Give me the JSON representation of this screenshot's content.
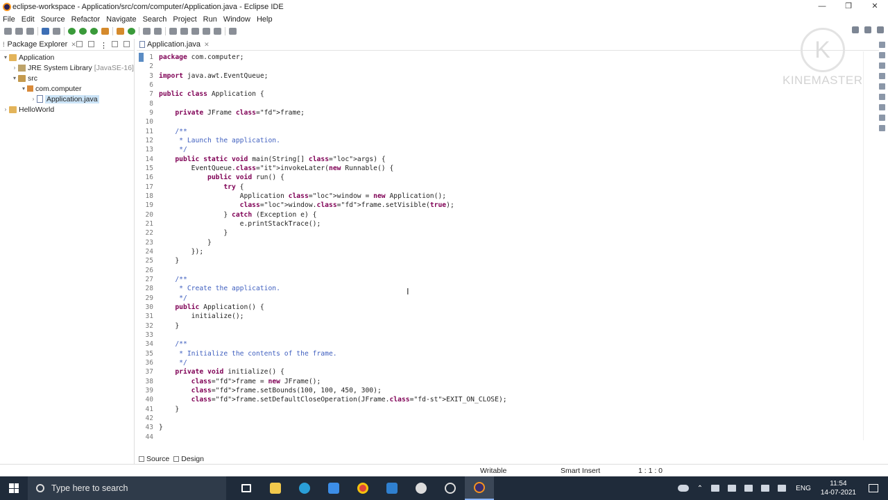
{
  "window": {
    "title": "eclipse-workspace - Application/src/com/computer/Application.java - Eclipse IDE",
    "controls": [
      "—",
      "❐",
      "✕"
    ]
  },
  "menu": [
    "File",
    "Edit",
    "Source",
    "Refactor",
    "Navigate",
    "Search",
    "Project",
    "Run",
    "Window",
    "Help"
  ],
  "explorer": {
    "tab_label": "Package Explorer",
    "tree": [
      {
        "label": "Application",
        "extra": "",
        "indent": 0,
        "arrow": "▾",
        "icon": "project-icon"
      },
      {
        "label": "JRE System Library",
        "extra": "[JavaSE-16]",
        "indent": 1,
        "arrow": "›",
        "icon": "library-icon"
      },
      {
        "label": "src",
        "extra": "",
        "indent": 1,
        "arrow": "▾",
        "icon": "source-folder-icon"
      },
      {
        "label": "com.computer",
        "extra": "",
        "indent": 2,
        "arrow": "▾",
        "icon": "package-icon"
      },
      {
        "label": "Application.java",
        "extra": "",
        "indent": 3,
        "arrow": "›",
        "icon": "java-file-icon"
      },
      {
        "label": "HelloWorld",
        "extra": "",
        "indent": 0,
        "arrow": "›",
        "icon": "project-icon"
      }
    ]
  },
  "editor": {
    "tab_label": "Application.java",
    "code_lines": [
      "package com.computer;",
      "",
      "import java.awt.EventQueue;",
      "",
      "public class Application {",
      "",
      "    private JFrame frame;",
      "",
      "    /**",
      "     * Launch the application.",
      "     */",
      "    public static void main(String[] args) {",
      "        EventQueue.invokeLater(new Runnable() {",
      "            public void run() {",
      "                try {",
      "                    Application window = new Application();",
      "                    window.frame.setVisible(true);",
      "                } catch (Exception e) {",
      "                    e.printStackTrace();",
      "                }",
      "            }",
      "        });",
      "    }",
      "",
      "    /**",
      "     * Create the application.",
      "     */",
      "    public Application() {",
      "        initialize();",
      "    }",
      "",
      "    /**",
      "     * Initialize the contents of the frame.",
      "     */",
      "    private void initialize() {",
      "        frame = new JFrame();",
      "        frame.setBounds(100, 100, 450, 300);",
      "        frame.setDefaultCloseOperation(JFrame.EXIT_ON_CLOSE);",
      "    }",
      "",
      "}",
      ""
    ],
    "line_numbers": [
      "1",
      "2",
      "3",
      "6",
      "7",
      "8",
      "9",
      "10",
      "11",
      "12",
      "13",
      "14",
      "15",
      "16",
      "17",
      "18",
      "19",
      "20",
      "21",
      "22",
      "23",
      "24",
      "25",
      "26",
      "27",
      "28",
      "29",
      "30",
      "31",
      "32",
      "33",
      "34",
      "35",
      "36",
      "37",
      "38",
      "39",
      "40",
      "41",
      "42",
      "43",
      "44"
    ],
    "bottom_tabs": [
      "Source",
      "Design"
    ]
  },
  "status": {
    "writable": "Writable",
    "insert_mode": "Smart Insert",
    "position": "1 : 1 : 0"
  },
  "watermark": {
    "letter": "K",
    "text": "KINEMASTER"
  },
  "taskbar": {
    "search_placeholder": "Type here to search",
    "language": "ENG",
    "time": "11:54",
    "date": "14-07-2021"
  }
}
